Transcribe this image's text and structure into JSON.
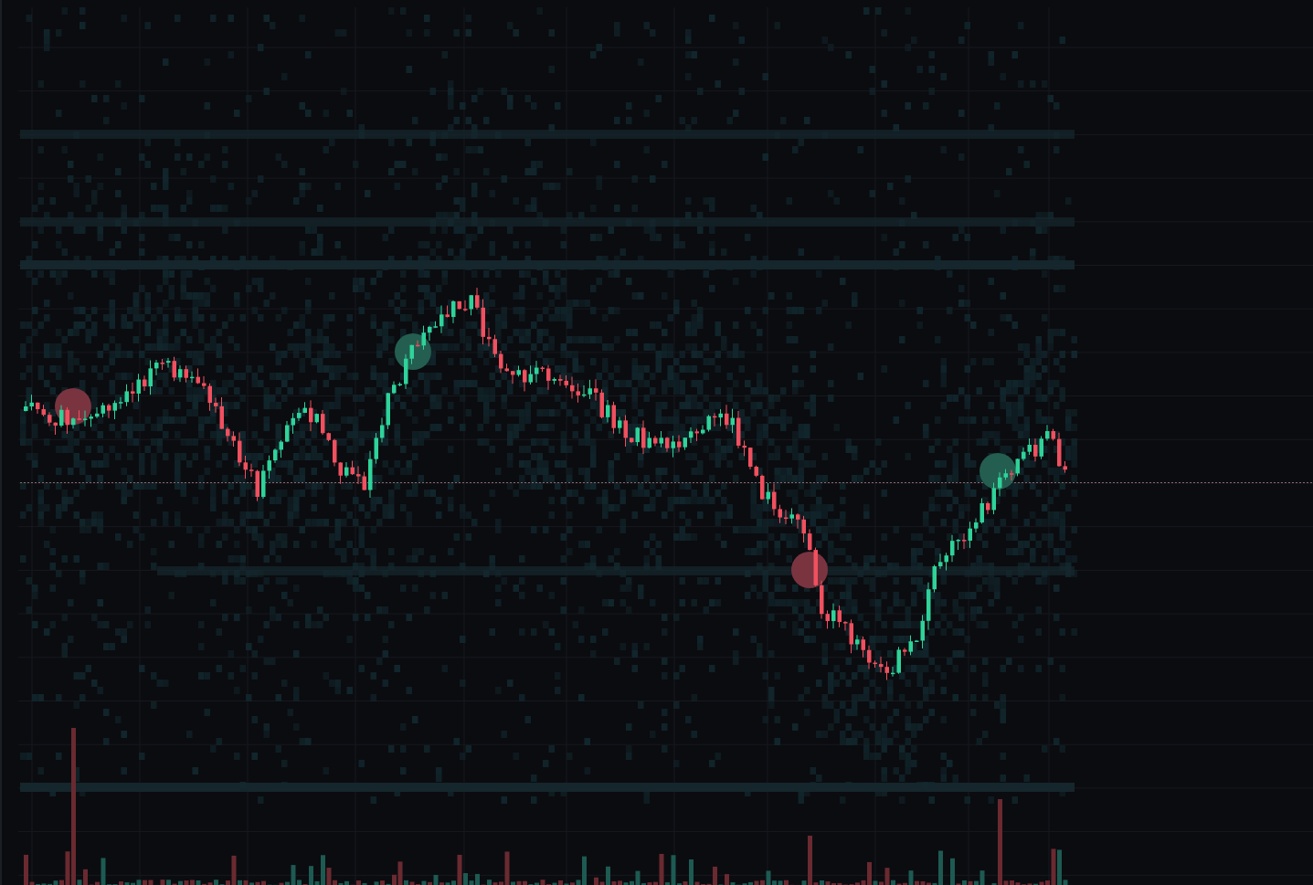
{
  "chart": {
    "markers": [
      {
        "color": "#7a3440"
      },
      {
        "color": "#245e50"
      },
      {
        "color": "#7a3440"
      },
      {
        "color": "#245e50"
      }
    ]
  }
}
